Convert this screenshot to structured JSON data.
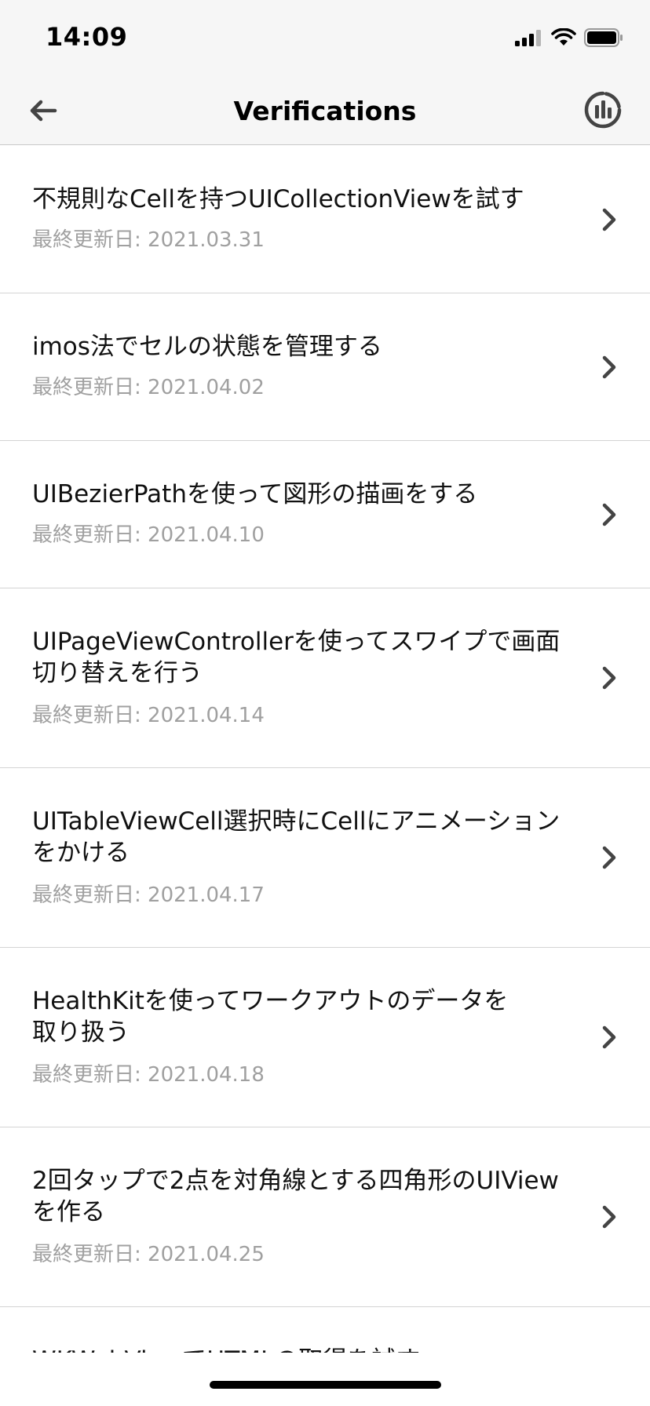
{
  "status_bar": {
    "time": "14:09"
  },
  "nav": {
    "title": "Verifications",
    "back_icon": "arrow-left-icon",
    "right_icon": "chart-icon"
  },
  "items": [
    {
      "title": "不規則なCellを持つUICollectionViewを試す",
      "title_line2": "",
      "date": "最終更新日: 2021.03.31"
    },
    {
      "title": "imos法でセルの状態を管理する",
      "title_line2": "",
      "date": "最終更新日: 2021.04.02"
    },
    {
      "title": "UIBezierPathを使って図形の描画をする",
      "title_line2": "",
      "date": "最終更新日: 2021.04.10"
    },
    {
      "title": "UIPageViewControllerを使ってスワイプで画面",
      "title_line2": "切り替えを行う",
      "date": "最終更新日: 2021.04.14"
    },
    {
      "title": "UITableViewCell選択時にCellにアニメーション",
      "title_line2": "をかける",
      "date": "最終更新日: 2021.04.17"
    },
    {
      "title": "HealthKitを使ってワークアウトのデータを",
      "title_line2": "取り扱う",
      "date": "最終更新日: 2021.04.18"
    },
    {
      "title": "2回タップで2点を対角線とする四角形のUIView",
      "title_line2": "を作る",
      "date": "最終更新日: 2021.04.25"
    }
  ],
  "partial_item": {
    "title": "WKWebViewでHTMLの取得を試す"
  },
  "colors": {
    "bar_background": "#f6f6f6",
    "separator": "#d4d4d4",
    "date_text": "#a0a0a0",
    "icon": "#444444"
  }
}
